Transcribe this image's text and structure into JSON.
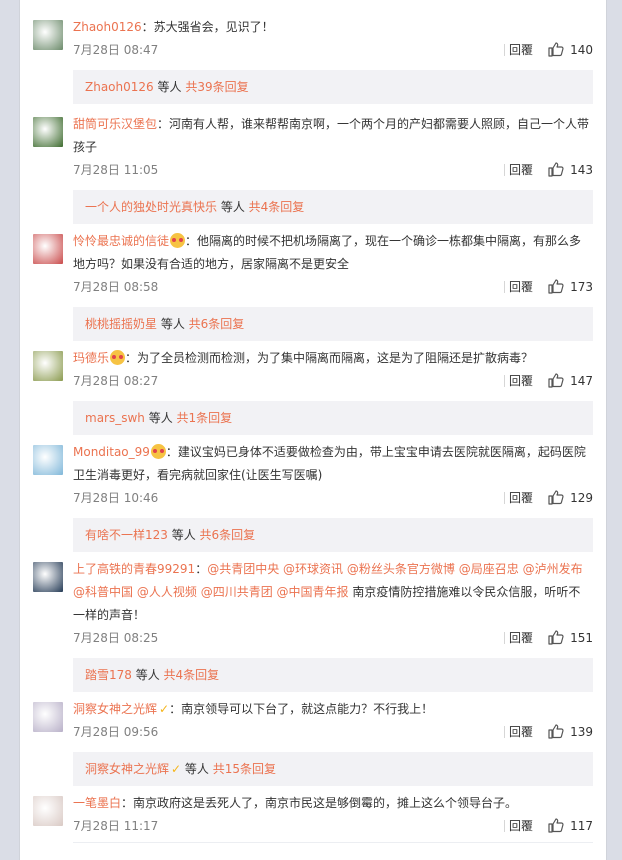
{
  "comments": [
    {
      "user": "Zhaoh0126",
      "badge": null,
      "content": "：苏大强省会，见识了！",
      "time": "7月28日 08:47",
      "reply": "回覆",
      "likes": "140",
      "sub": {
        "user": "Zhaoh0126",
        "mid": " 等人 ",
        "count": "共39条回复"
      }
    },
    {
      "user": "甜筒可乐汉堡包",
      "badge": null,
      "content": "：河南有人帮，谁来帮帮南京啊，一个两个月的产妇都需要人照顾，自己一个人带孩子",
      "time": "7月28日 11:05",
      "reply": "回覆",
      "likes": "143",
      "sub": {
        "user": "一个人的独处时光真快乐",
        "mid": " 等人 ",
        "count": "共4条回复"
      }
    },
    {
      "user": "怜怜最忠诚的信徒",
      "badge": "emoji",
      "content": "：他隔离的时候不把机场隔离了，现在一个确诊一栋都集中隔离，有那么多地方吗？如果没有合适的地方，居家隔离不是更安全",
      "time": "7月28日 08:58",
      "reply": "回覆",
      "likes": "173",
      "sub": {
        "user": "桃桃摇摇奶星",
        "mid": " 等人 ",
        "count": "共6条回复"
      }
    },
    {
      "user": "玛德乐",
      "badge": "emoji",
      "content": "：为了全员检测而检测，为了集中隔离而隔离，这是为了阻隔还是扩散病毒？",
      "time": "7月28日 08:27",
      "reply": "回覆",
      "likes": "147",
      "sub": {
        "user": "mars_swh",
        "mid": " 等人 ",
        "count": "共1条回复"
      }
    },
    {
      "user": "Monditao_99",
      "badge": "emoji",
      "content": "：建议宝妈已身体不适要做检查为由，带上宝宝申请去医院就医隔离，起码医院卫生消毒更好，看完病就回家住(让医生写医嘱)",
      "time": "7月28日 10:46",
      "reply": "回覆",
      "likes": "129",
      "sub": {
        "user": "有啥不一样123",
        "mid": " 等人 ",
        "count": "共6条回复"
      }
    },
    {
      "user": "上了高铁的青春99291",
      "badge": null,
      "content_parts": [
        {
          "t": "：",
          "m": false
        },
        {
          "t": "@共青团中央",
          "m": true
        },
        {
          "t": " ",
          "m": false
        },
        {
          "t": "@环球资讯",
          "m": true
        },
        {
          "t": " ",
          "m": false
        },
        {
          "t": "@粉丝头条官方微博",
          "m": true
        },
        {
          "t": " ",
          "m": false
        },
        {
          "t": "@局座召忠",
          "m": true
        },
        {
          "t": " ",
          "m": false
        },
        {
          "t": "@泸州发布",
          "m": true
        },
        {
          "t": " ",
          "m": false
        },
        {
          "t": "@科普中国",
          "m": true
        },
        {
          "t": " ",
          "m": false
        },
        {
          "t": "@人人视频",
          "m": true
        },
        {
          "t": " ",
          "m": false
        },
        {
          "t": "@四川共青团",
          "m": true
        },
        {
          "t": " ",
          "m": false
        },
        {
          "t": "@中国青年报",
          "m": true
        },
        {
          "t": " 南京疫情防控措施难以令民众信服，听听不一样的声音！",
          "m": false
        }
      ],
      "time": "7月28日 08:25",
      "reply": "回覆",
      "likes": "151",
      "sub": {
        "user": "踏雪178",
        "mid": " 等人 ",
        "count": "共4条回复"
      }
    },
    {
      "user": "洞察女神之光辉",
      "badge": "v",
      "content": "：南京领导可以下台了，就这点能力？不行我上！",
      "time": "7月28日 09:56",
      "reply": "回覆",
      "likes": "139",
      "sub": {
        "user": "洞察女神之光辉",
        "mid": " 等人 ",
        "count": "共15条回复",
        "badge": "v"
      }
    },
    {
      "user": "一笔墨白",
      "badge": null,
      "content": "：南京政府这是丢死人了，南京市民这是够倒霉的，摊上这么个领导台子。",
      "time": "7月28日 11:17",
      "reply": "回覆",
      "likes": "117",
      "sub": null
    }
  ],
  "icons": {
    "like": "thumbs-up-icon",
    "badge_emoji": "fan-emoji-icon",
    "badge_v": "v-badge-icon"
  },
  "colors": {
    "username": "#eb7350",
    "text": "#333333",
    "meta": "#808080",
    "subbox": "#f2f2f5"
  }
}
